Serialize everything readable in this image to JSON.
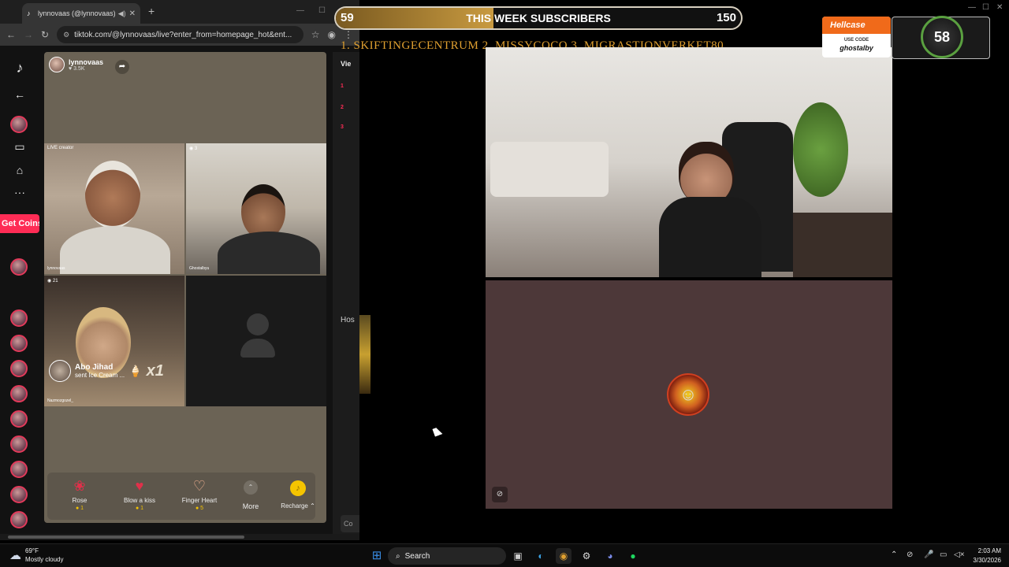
{
  "browser": {
    "tab_title": "lynnovaas (@lynnovaas) is LIVE",
    "url": "tiktok.com/@lynnovaas/live?enter_from=homepage_hot&ent..."
  },
  "tiktok": {
    "get_coins": "Get Coins",
    "host": {
      "name": "lynnovaas",
      "likes": "3.5K"
    },
    "cells": {
      "cam1_tag": "LIVE creator",
      "cam1_name": "lynnovaas",
      "cam2_tag": "3",
      "cam2_name": "Ghostalbyu",
      "cam3_tag": "21",
      "cam3_name": "Nazmozgozel_"
    },
    "gift_toast": {
      "name": "Abo Jihad",
      "text": "sent Ice Cream ...",
      "count": "x1"
    },
    "gifts": [
      {
        "label": "Rose",
        "price": "1"
      },
      {
        "label": "Blow a kiss",
        "price": "1"
      },
      {
        "label": "Finger Heart",
        "price": "5"
      }
    ],
    "more": "More",
    "recharge": "Recharge",
    "right_panel": {
      "viewers": "Vie",
      "ranks": [
        "1",
        "2",
        "3"
      ],
      "host_label": "Hos",
      "comment": "Co"
    }
  },
  "overlay": {
    "subs_current": "59",
    "subs_title": "THIS WEEK SUBSCRIBERS",
    "subs_goal": "150",
    "subs_progress": 0.39,
    "leaderboard": "1. SKIFTINGECENTRUM  2. MISSYCOCO  3. MIGRASTIONVERKET80",
    "hellcase": {
      "brand": "Hellcase",
      "use_code": "USE CODE",
      "code": "ghostalby"
    },
    "badge_level": "58"
  },
  "taskbar": {
    "temp": "69°F",
    "condition": "Mostly cloudy",
    "search": "Search",
    "time": "2:03 AM",
    "date": "3/30/2026"
  }
}
